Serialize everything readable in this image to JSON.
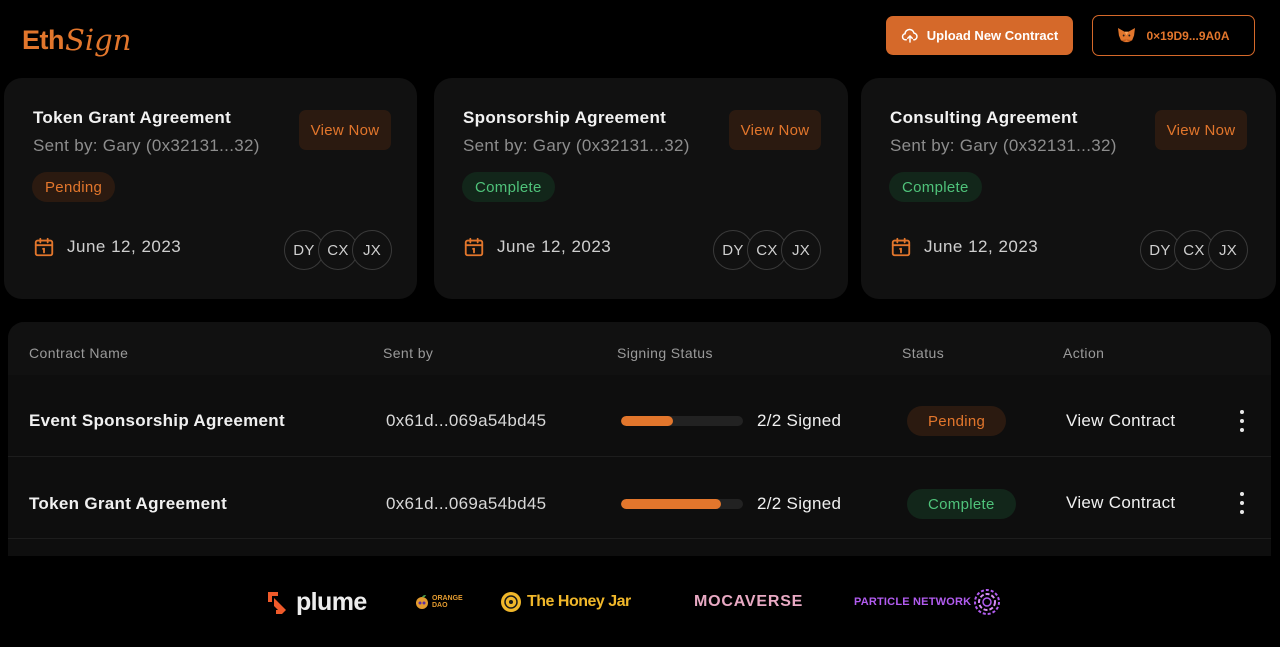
{
  "brand": {
    "eth": "Eth",
    "sign": "Sign",
    "accent": "#e2762c"
  },
  "header": {
    "upload_label": "Upload New Contract",
    "upload_icon": "cloud-upload-icon",
    "wallet_address": "0×19D9...9A0A",
    "wallet_icon": "metamask-fox-icon"
  },
  "cards": [
    {
      "title": "Token Grant Agreement",
      "sender": "Sent by: Gary (0x32131...32)",
      "action": "View Now",
      "status": "Pending",
      "date": "June 12, 2023",
      "signers": [
        "DY",
        "CX",
        "JX"
      ]
    },
    {
      "title": "Sponsorship Agreement",
      "sender": "Sent by: Gary (0x32131...32)",
      "action": "View Now",
      "status": "Complete",
      "date": "June 12, 2023",
      "signers": [
        "DY",
        "CX",
        "JX"
      ]
    },
    {
      "title": "Consulting Agreement",
      "sender": "Sent by: Gary (0x32131...32)",
      "action": "View Now",
      "status": "Complete",
      "date": "June 12, 2023",
      "signers": [
        "DY",
        "CX",
        "JX"
      ]
    }
  ],
  "table": {
    "headers": [
      "Contract Name",
      "Sent by",
      "Signing Status",
      "Status",
      "Action"
    ],
    "rows": [
      {
        "name": "Event Sponsorship Agreement",
        "sender": "0x61d...069a54bd45",
        "progress": 0.43,
        "signed": "2/2 Signed",
        "status": "Pending",
        "action": "View Contract"
      },
      {
        "name": "Token Grant Agreement",
        "sender": "0x61d...069a54bd45",
        "progress": 0.82,
        "signed": "2/2 Signed",
        "status": "Complete",
        "action": "View Contract"
      }
    ]
  },
  "partners": {
    "plume": "plume",
    "orange_dao_line1": "ORANGE",
    "orange_dao_line2": "DAO",
    "honey_jar": "The Honey Jar",
    "mocaverse": "MOCAVERSE",
    "particle": "PARTICLE NETWORK"
  }
}
